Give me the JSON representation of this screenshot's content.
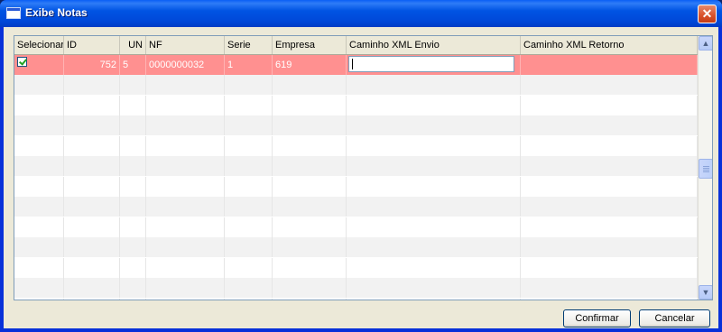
{
  "window": {
    "title": "Exibe Notas",
    "close_glyph": "✕"
  },
  "grid": {
    "columns": [
      "Selecionar",
      "ID",
      "UN",
      "NF",
      "Serie",
      "Empresa",
      "Caminho XML Envio",
      "Caminho XML Retorno"
    ],
    "selected_row": {
      "selecionar": true,
      "id": "752",
      "un": "5",
      "nf": "0000000032",
      "serie": "1",
      "empresa": "619",
      "caminho_xml_envio": "",
      "caminho_xml_retorno": ""
    },
    "empty_row_count": 12,
    "colors": {
      "selected_row_bg": "#ff9090",
      "alt_row_bg": "#f2f2f2",
      "header_bg": "#ece9d8"
    }
  },
  "scrollbar": {
    "up_glyph": "▲",
    "down_glyph": "▼"
  },
  "buttons": {
    "confirm": "Confirmar",
    "cancel": "Cancelar"
  }
}
